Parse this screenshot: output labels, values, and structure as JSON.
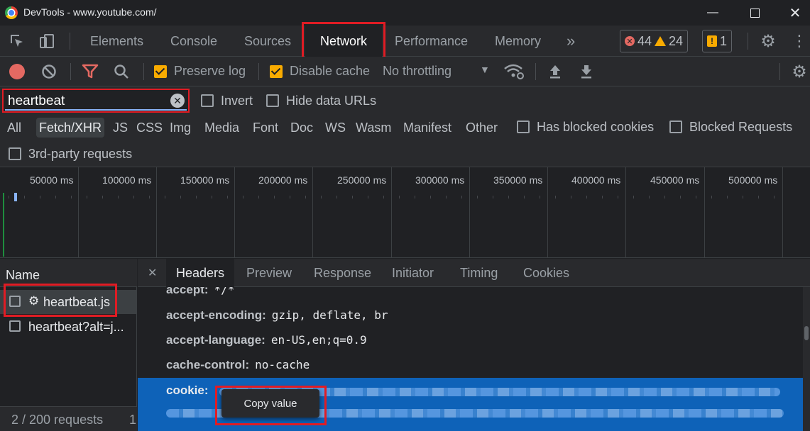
{
  "window": {
    "title": "DevTools - www.youtube.com/"
  },
  "main_tabs": [
    "Elements",
    "Console",
    "Sources",
    "Network",
    "Performance",
    "Memory"
  ],
  "main_tabs_active": "Network",
  "counters": {
    "errors": "44",
    "warnings": "24",
    "issues": "1"
  },
  "toolbar": {
    "preserve_log": {
      "label": "Preserve log",
      "checked": true
    },
    "disable_cache": {
      "label": "Disable cache",
      "checked": true
    },
    "throttling": "No throttling"
  },
  "filter": {
    "value": "heartbeat",
    "invert_label": "Invert",
    "hide_data_urls_label": "Hide data URLs"
  },
  "type_filters": [
    "All",
    "Fetch/XHR",
    "JS",
    "CSS",
    "Img",
    "Media",
    "Font",
    "Doc",
    "WS",
    "Wasm",
    "Manifest",
    "Other"
  ],
  "type_filters_active": "Fetch/XHR",
  "extra_filters": {
    "has_blocked_cookies": "Has blocked cookies",
    "blocked_requests": "Blocked Requests",
    "third_party": "3rd-party requests"
  },
  "timeline_ticks": [
    "50000 ms",
    "100000 ms",
    "150000 ms",
    "200000 ms",
    "250000 ms",
    "300000 ms",
    "350000 ms",
    "400000 ms",
    "450000 ms",
    "500000 ms"
  ],
  "name_column": {
    "header": "Name",
    "rows": [
      "heartbeat.js",
      "heartbeat?alt=j..."
    ],
    "status": "2 / 200 requests",
    "status_trail": "1"
  },
  "detail_tabs": [
    "Headers",
    "Preview",
    "Response",
    "Initiator",
    "Timing",
    "Cookies"
  ],
  "detail_tabs_active": "Headers",
  "headers": [
    {
      "key": "accept:",
      "value": "*/*"
    },
    {
      "key": "accept-encoding:",
      "value": "gzip, deflate, br"
    },
    {
      "key": "accept-language:",
      "value": "en-US,en;q=0.9"
    },
    {
      "key": "cache-control:",
      "value": "no-cache"
    },
    {
      "key": "cookie:",
      "value": ""
    }
  ],
  "context_menu": {
    "item": "Copy value"
  },
  "colors": {
    "highlight_red": "#e01c24",
    "selection_blue": "#0e62b8",
    "checkbox_orange": "#f9ab00"
  }
}
